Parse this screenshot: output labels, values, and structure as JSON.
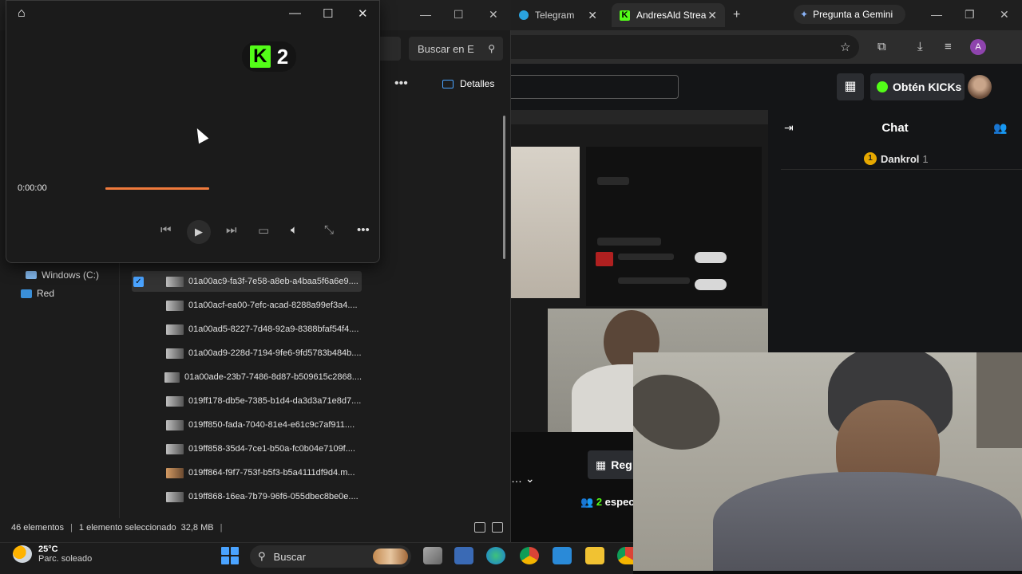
{
  "player": {
    "logo_letter": "K",
    "logo_number": "2",
    "time": "0:00:00",
    "progress": 1.0,
    "icons": [
      "home-icon",
      "minimize-icon",
      "maximize-icon",
      "close-icon",
      "previous-icon",
      "play-icon",
      "next-icon",
      "subtitles-icon",
      "volume-icon",
      "miniplayer-icon",
      "more-icon"
    ]
  },
  "explorer": {
    "search_placeholder": "Buscar en E",
    "details_label": "Detalles",
    "nav": [
      "Windows (C:)",
      "Red"
    ],
    "files": [
      "01a00ac9-fa3f-7e58-a8eb-a4baa5f6a6e9....",
      "01a00acf-ea00-7efc-acad-8288a99ef3a4....",
      "01a00ad5-8227-7d48-92a9-8388bfaf54f4....",
      "01a00ad9-228d-7194-9fe6-9fd5783b484b....",
      "01a00ade-23b7-7486-8d87-b509615c2868....",
      "019ff178-db5e-7385-b1d4-da3d3a71e8d7....",
      "019ff850-fada-7040-81e4-e61c9c7af911....",
      "019ff858-35d4-7ce1-b50a-fc0b04e7109f....",
      "019ff864-f9f7-753f-b5f3-b5a4111df9d4.m...",
      "019ff868-16ea-7b79-96f6-055dbec8be0e...."
    ],
    "status": {
      "count": "46 elementos",
      "selected": "1 elemento seleccionado",
      "size": "32,8 MB"
    }
  },
  "browser": {
    "tabs": [
      "Telegram",
      "AndresAld Strea"
    ],
    "gemini_label": "Pregunta a Gemini",
    "profile_initial": "A",
    "kick": {
      "kicks_button": "Obtén KICKs",
      "chat_title": "Chat",
      "chat_user": "Dankrol",
      "chat_count": "1",
      "register_label": "Reg",
      "viewers_count": "2",
      "viewers_label": "espec"
    }
  },
  "taskbar": {
    "temperature": "25°C",
    "weather": "Parc. soleado",
    "search_label": "Buscar"
  },
  "colors": {
    "kick_green": "#53fc18",
    "progress_orange": "#f07a3c",
    "accent_blue": "#4aa3ff"
  }
}
